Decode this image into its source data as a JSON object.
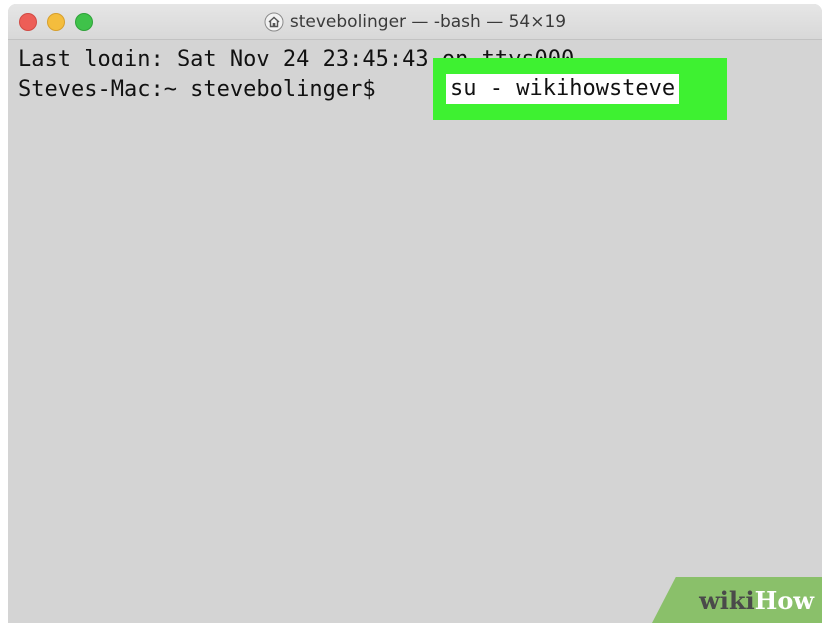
{
  "window": {
    "title": "stevebolinger — -bash — 54×19",
    "title_icon": "home-icon"
  },
  "terminal": {
    "login_line": "Last login: Sat Nov 24 23:45:43 on ttys000",
    "prompt": "Steves-Mac:~ stevebolinger$ ",
    "command": "su - wikihowsteve"
  },
  "watermark": {
    "part1": "wiki",
    "part2": "How"
  },
  "colors": {
    "highlight": "#3ef131",
    "background": "#d4d4d4",
    "close": "#ed5e57",
    "minimize": "#f4bd3d",
    "maximize": "#3fc24a"
  }
}
